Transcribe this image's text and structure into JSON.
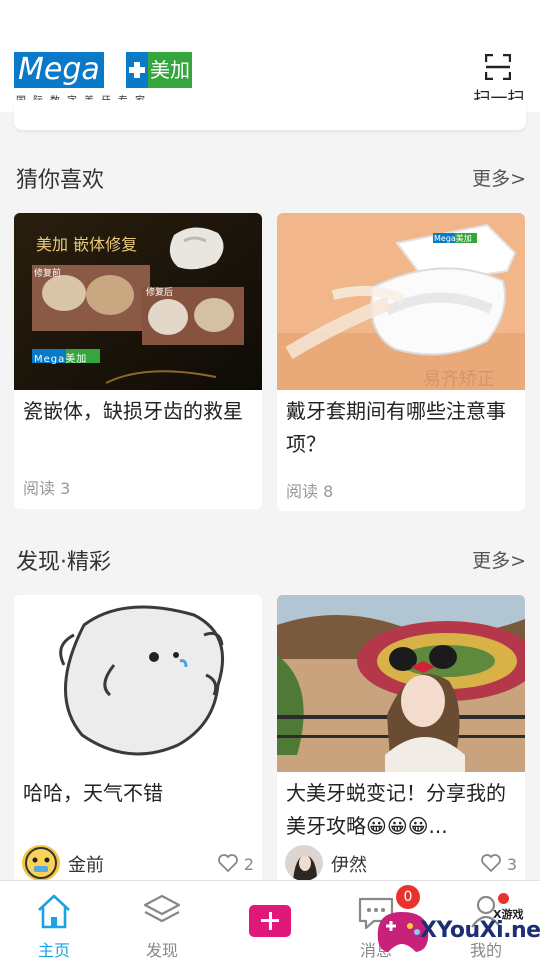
{
  "header": {
    "logo": {
      "brand_en": "Mega",
      "brand_cn": "美加",
      "tagline": "国际数字美牙专家"
    },
    "scan_label": "扫一扫"
  },
  "recommend": {
    "title": "猜你喜欢",
    "more": "更多>",
    "cards": [
      {
        "image_title": "美加 嵌体修复",
        "image_before": "修复前",
        "image_after": "修复后",
        "image_brand": "Mega美加",
        "title": "瓷嵌体，缺损牙齿的救星",
        "reads": "阅读 3"
      },
      {
        "image_case_brand": "Mega美加",
        "image_caption": "易齐矫正",
        "title": "戴牙套期间有哪些注意事项？",
        "reads": "阅读 8"
      }
    ]
  },
  "discover": {
    "title": "发现·精彩",
    "more": "更多>",
    "cards": [
      {
        "title": "哈哈，天气不错",
        "user": "金前",
        "likes": "2"
      },
      {
        "title": "大美牙蜕变记！分享我的美牙攻略😀😀😀...",
        "user": "伊然",
        "likes": "3"
      }
    ]
  },
  "tabbar": {
    "tabs": [
      {
        "label": "主页",
        "icon": "home-icon",
        "active": true
      },
      {
        "label": "发现",
        "icon": "layers-icon",
        "active": false
      },
      {
        "label": "",
        "icon": "plus-icon",
        "active": false
      },
      {
        "label": "消息",
        "icon": "message-icon",
        "active": false
      },
      {
        "label": "我的",
        "icon": "user-icon",
        "active": false
      }
    ],
    "message_badge": "0"
  },
  "watermark": {
    "main": "XYouXi.net",
    "sub": "X游戏"
  },
  "colors": {
    "accent": "#19a2e4",
    "brand_blue": "#0a79c7",
    "brand_green": "#35a63d",
    "publish": "#e0187a",
    "badge": "#e8322f"
  }
}
